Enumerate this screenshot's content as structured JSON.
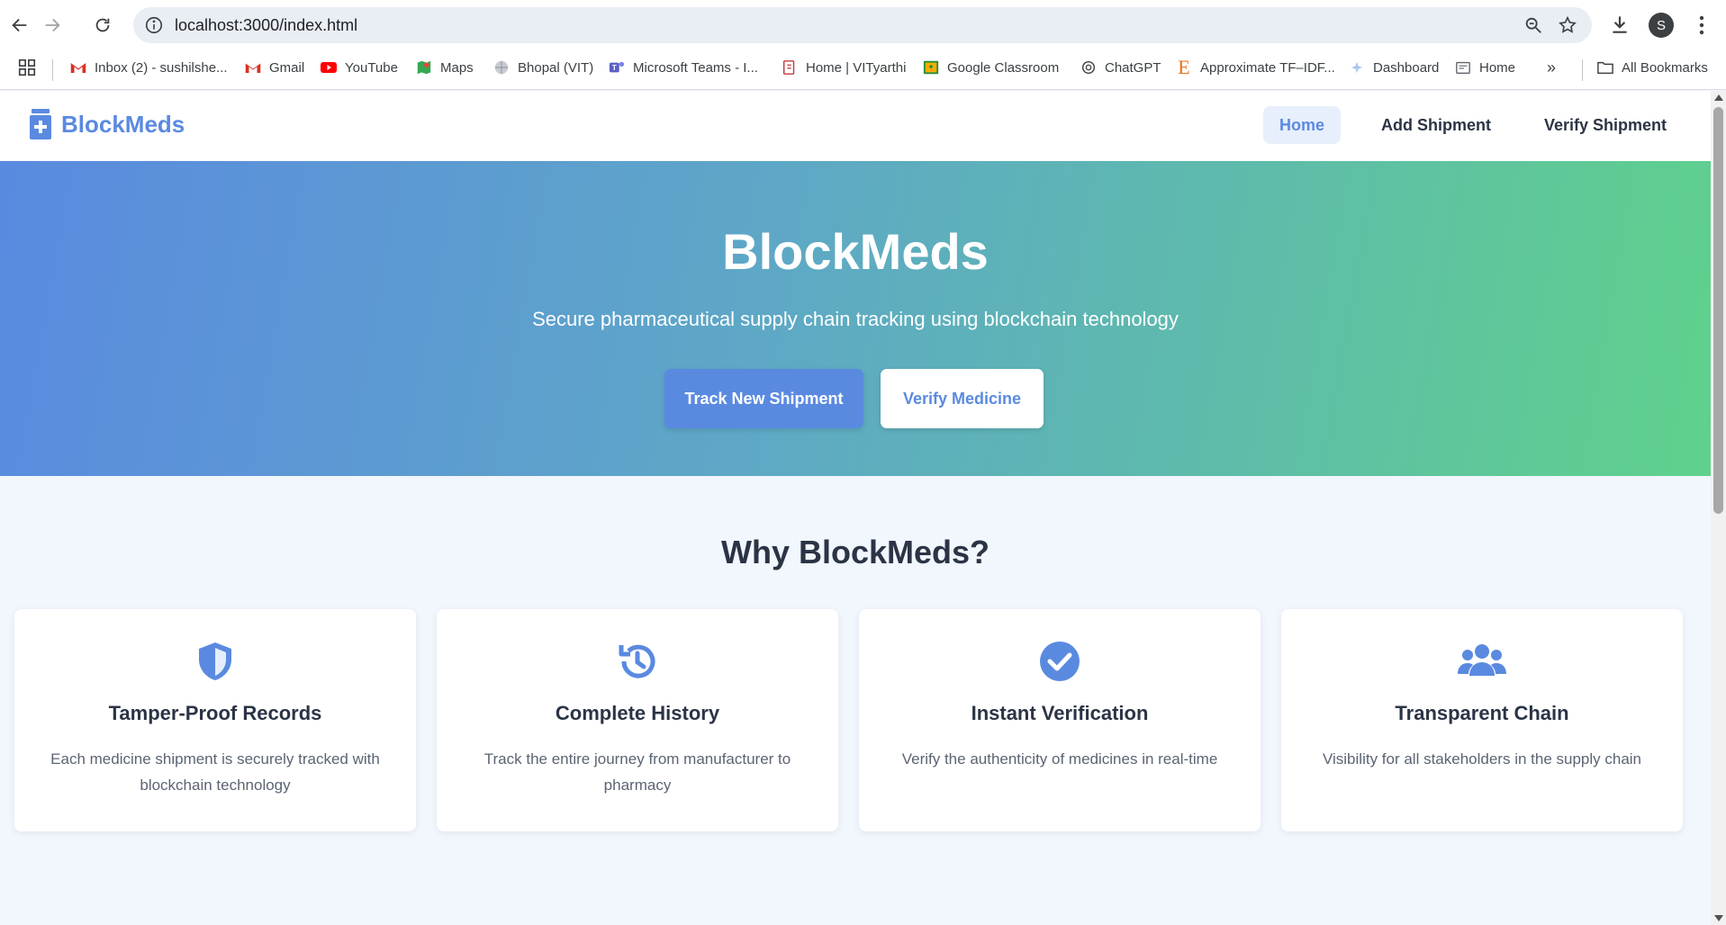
{
  "browser": {
    "url": "localhost:3000/index.html",
    "profile_initial": "S",
    "bookmarks": [
      {
        "label": "Inbox (2) - sushilshe...",
        "icon": "gmail-icon"
      },
      {
        "label": "Gmail",
        "icon": "gmail-icon"
      },
      {
        "label": "YouTube",
        "icon": "youtube-icon"
      },
      {
        "label": "Maps",
        "icon": "maps-icon"
      },
      {
        "label": "Bhopal (VIT)",
        "icon": "globe-icon"
      },
      {
        "label": "Microsoft Teams - I...",
        "icon": "teams-icon"
      },
      {
        "label": "Home | VITyarthi",
        "icon": "vityarthi-icon"
      },
      {
        "label": "Google Classroom",
        "icon": "classroom-icon"
      },
      {
        "label": "ChatGPT",
        "icon": "chatgpt-icon"
      },
      {
        "label": "Approximate TF–IDF...",
        "icon": "e-icon"
      },
      {
        "label": "Dashboard",
        "icon": "dashboard-icon"
      },
      {
        "label": "Home",
        "icon": "home-page-icon"
      }
    ],
    "more_bookmarks": "»",
    "all_bookmarks": "All Bookmarks"
  },
  "site": {
    "brand": "BlockMeds",
    "nav": {
      "home": "Home",
      "add_shipment": "Add Shipment",
      "verify_shipment": "Verify Shipment"
    },
    "hero": {
      "title": "BlockMeds",
      "subtitle": "Secure pharmaceutical supply chain tracking using blockchain technology",
      "primary_cta": "Track New Shipment",
      "secondary_cta": "Verify Medicine"
    },
    "features": {
      "title": "Why BlockMeds?",
      "items": [
        {
          "icon": "shield-icon",
          "title": "Tamper-Proof Records",
          "description": "Each medicine shipment is securely tracked with blockchain technology"
        },
        {
          "icon": "history-icon",
          "title": "Complete History",
          "description": "Track the entire journey from manufacturer to pharmacy"
        },
        {
          "icon": "check-circle-icon",
          "title": "Instant Verification",
          "description": "Verify the authenticity of medicines in real-time"
        },
        {
          "icon": "users-icon",
          "title": "Transparent Chain",
          "description": "Visibility for all stakeholders in the supply chain"
        }
      ]
    }
  },
  "colors": {
    "accent": "#5a8ae0",
    "gradient_end": "#5fd18c",
    "text_dark": "#2b3445",
    "page_bg": "#f2f6fd"
  }
}
